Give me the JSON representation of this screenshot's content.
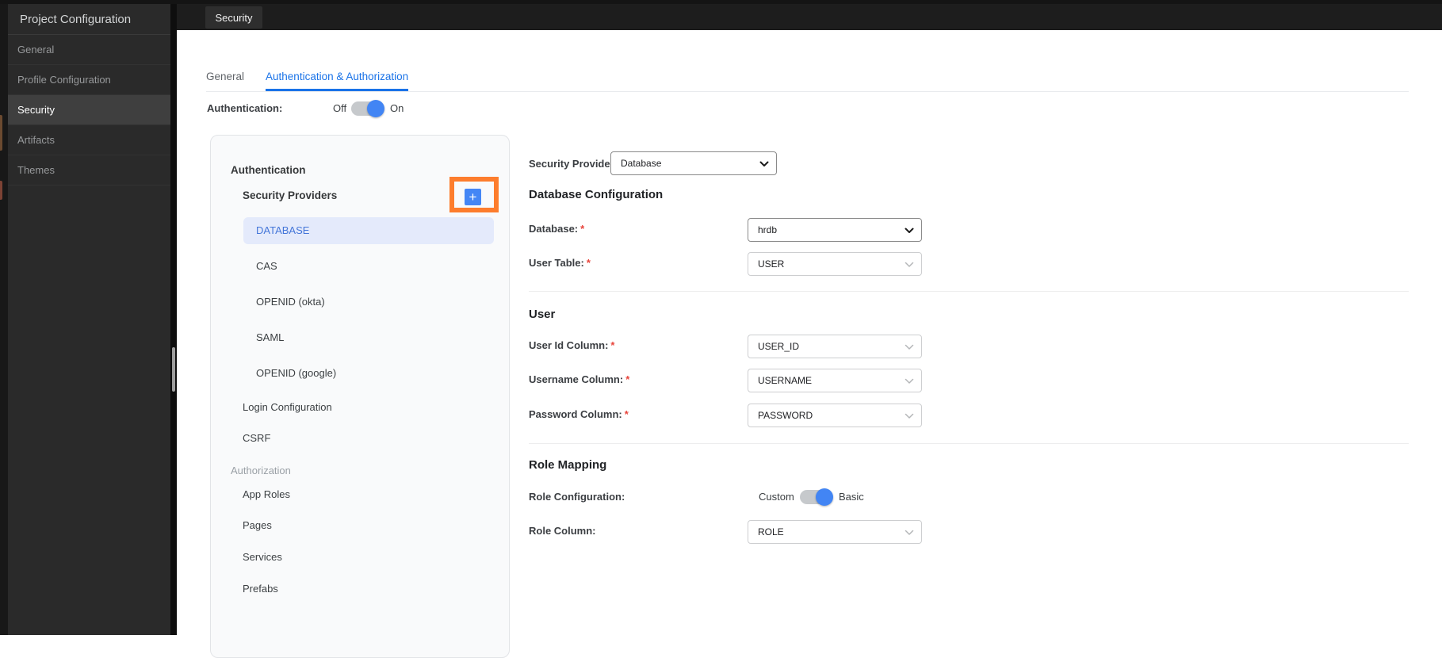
{
  "colors": {
    "accent_blue": "#1a73e8",
    "toggle_blue": "#4285f4",
    "selected_row_bg": "#e4eafb",
    "selected_row_text": "#4476d9",
    "highlight_orange": "#fd7d2d",
    "sidebar_bg": "#2a2a2a",
    "topbar_bg": "#1d1d1d",
    "required_red": "#e8453c"
  },
  "sidebar": {
    "title": "Project Configuration",
    "items": [
      {
        "label": "General",
        "selected": false
      },
      {
        "label": "Profile Configuration",
        "selected": false
      },
      {
        "label": "Security",
        "selected": true
      },
      {
        "label": "Artifacts",
        "selected": false
      },
      {
        "label": "Themes",
        "selected": false
      }
    ]
  },
  "topbar": {
    "active_tab": "Security"
  },
  "content_tabs": {
    "tabs": [
      {
        "label": "General",
        "active": false
      },
      {
        "label": "Authentication & Authorization",
        "active": true
      }
    ]
  },
  "auth_switch": {
    "label": "Authentication:",
    "off_label": "Off",
    "on_label": "On",
    "state": "On"
  },
  "nav_panel": {
    "section_authentication": "Authentication",
    "security_providers_label": "Security Providers",
    "add_button": {
      "icon": "plus-icon",
      "glyph": "+"
    },
    "providers": [
      {
        "label": "DATABASE",
        "selected": true
      },
      {
        "label": "CAS",
        "selected": false
      },
      {
        "label": "OPENID (okta)",
        "selected": false
      },
      {
        "label": "SAML",
        "selected": false
      },
      {
        "label": "OPENID (google)",
        "selected": false
      }
    ],
    "items": [
      {
        "label": "Login Configuration"
      },
      {
        "label": "CSRF"
      }
    ],
    "section_authorization": "Authorization",
    "authorization_items": [
      {
        "label": "App Roles"
      },
      {
        "label": "Pages"
      },
      {
        "label": "Services"
      },
      {
        "label": "Prefabs"
      }
    ]
  },
  "form": {
    "required_mark": "*",
    "provider": {
      "label": "Security Provider",
      "value": "Database"
    },
    "database_section": {
      "title": "Database Configuration",
      "database": {
        "label": "Database:",
        "value": "hrdb"
      },
      "user_table": {
        "label": "User Table:",
        "value": "USER"
      }
    },
    "user_section": {
      "title": "User",
      "user_id": {
        "label": "User Id Column:",
        "value": "USER_ID"
      },
      "username": {
        "label": "Username Column:",
        "value": "USERNAME"
      },
      "password": {
        "label": "Password Column:",
        "value": "PASSWORD"
      }
    },
    "role_section": {
      "title": "Role Mapping",
      "role_configuration": {
        "label": "Role Configuration:",
        "left_label": "Custom",
        "right_label": "Basic",
        "state": "Basic"
      },
      "role_column": {
        "label": "Role Column:",
        "value": "ROLE"
      }
    }
  }
}
